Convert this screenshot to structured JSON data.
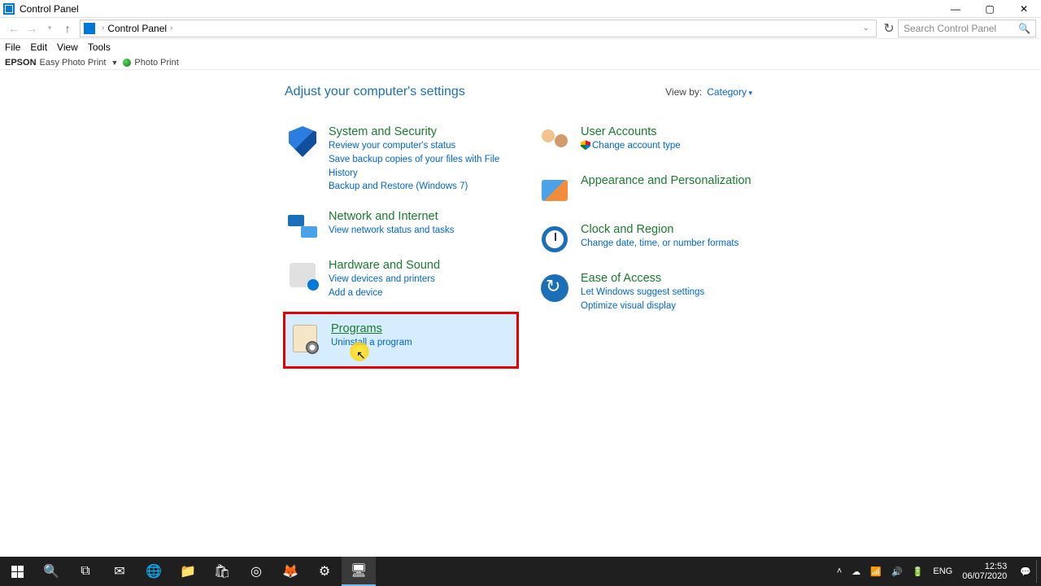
{
  "window": {
    "title": "Control Panel"
  },
  "address": {
    "crumb": "Control Panel",
    "search_placeholder": "Search Control Panel"
  },
  "menu": {
    "file": "File",
    "edit": "Edit",
    "view": "View",
    "tools": "Tools"
  },
  "epson": {
    "brand": "EPSON",
    "easy": "Easy Photo Print",
    "photo": "Photo Print"
  },
  "header": {
    "heading": "Adjust your computer's settings",
    "viewby_label": "View by:",
    "viewby_value": "Category"
  },
  "left": {
    "system": {
      "title": "System and Security",
      "l1": "Review your computer's status",
      "l2": "Save backup copies of your files with File History",
      "l3": "Backup and Restore (Windows 7)"
    },
    "network": {
      "title": "Network and Internet",
      "l1": "View network status and tasks"
    },
    "hardware": {
      "title": "Hardware and Sound",
      "l1": "View devices and printers",
      "l2": "Add a device"
    },
    "programs": {
      "title": "Programs",
      "l1": "Uninstall a program"
    }
  },
  "right": {
    "users": {
      "title": "User Accounts",
      "l1": "Change account type"
    },
    "appearance": {
      "title": "Appearance and Personalization"
    },
    "clock": {
      "title": "Clock and Region",
      "l1": "Change date, time, or number formats"
    },
    "ease": {
      "title": "Ease of Access",
      "l1": "Let Windows suggest settings",
      "l2": "Optimize visual display"
    }
  },
  "taskbar": {
    "lang": "ENG",
    "time": "12:53",
    "date": "06/07/2020"
  }
}
